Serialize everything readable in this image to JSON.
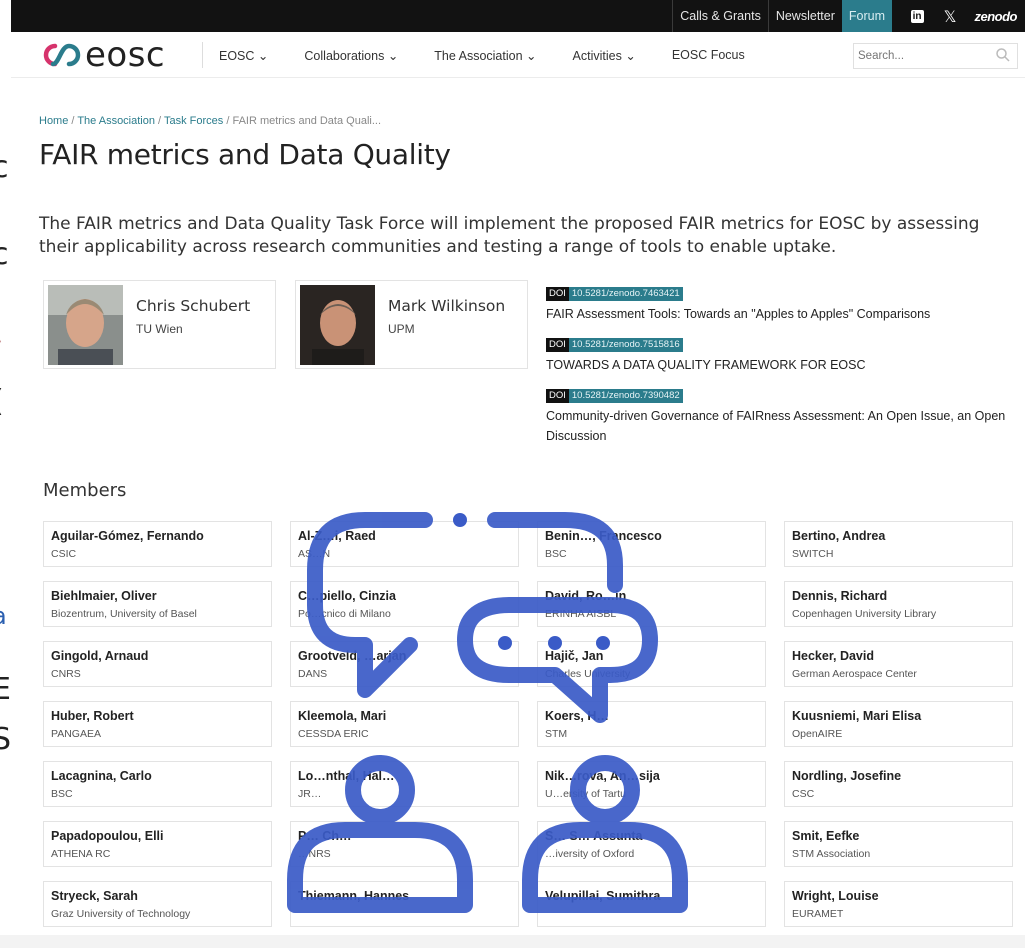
{
  "topbar": {
    "links": [
      "Calls & Grants",
      "Newsletter",
      "Forum"
    ],
    "social": {
      "linkedin": "in",
      "x": "𝕏",
      "zenodo": "zenodo"
    }
  },
  "nav": {
    "logo_text": "eosc",
    "menu": [
      "EOSC",
      "Collaborations",
      "The Association",
      "Activities",
      "EOSC Focus"
    ],
    "search_placeholder": "Search..."
  },
  "breadcrumbs": {
    "items": [
      "Home",
      "The Association",
      "Task Forces"
    ],
    "separator": "/",
    "current": "FAIR metrics and Data Quali..."
  },
  "page": {
    "title": "FAIR metrics and Data Quality",
    "lead": "The FAIR metrics and Data Quality Task Force will implement the proposed FAIR metrics for EOSC by assessing their applicability across research communities and testing a range of tools to enable uptake."
  },
  "leaders": [
    {
      "name": "Chris Schubert",
      "org": "TU Wien"
    },
    {
      "name": "Mark Wilkinson",
      "org": "UPM"
    }
  ],
  "publications": [
    {
      "doi_label": "DOI",
      "doi": "10.5281/zenodo.7463421",
      "title": "FAIR Assessment Tools: Towards an \"Apples to Apples\" Comparisons"
    },
    {
      "doi_label": "DOI",
      "doi": "10.5281/zenodo.7515816",
      "title": "TOWARDS A DATA QUALITY FRAMEWORK FOR EOSC"
    },
    {
      "doi_label": "DOI",
      "doi": "10.5281/zenodo.7390482",
      "title": "Community-driven Governance of FAIRness Assessment: An Open Issue, an Open Discussion"
    }
  ],
  "members_heading": "Members",
  "members": [
    {
      "name": "Aguilar-Gómez, Fernando",
      "org": "CSIC"
    },
    {
      "name": "Al-Z…i, Raed",
      "org": "AS…N"
    },
    {
      "name": "Benin…, Francesco",
      "org": "BSC"
    },
    {
      "name": "Bertino, Andrea",
      "org": "SWITCH"
    },
    {
      "name": "Biehlmaier, Oliver",
      "org": "Biozentrum, University of Basel"
    },
    {
      "name": "C…piello, Cinzia",
      "org": "Po…cnico di Milano"
    },
    {
      "name": "David, Ro…in",
      "org": "ERINHA AISBL"
    },
    {
      "name": "Dennis, Richard",
      "org": "Copenhagen University Library"
    },
    {
      "name": "Gingold, Arnaud",
      "org": "CNRS"
    },
    {
      "name": "Grootveld, …arjan",
      "org": "DANS"
    },
    {
      "name": "Hajič, Jan",
      "org": "Charles University"
    },
    {
      "name": "Hecker, David",
      "org": "German Aerospace Center"
    },
    {
      "name": "Huber, Robert",
      "org": "PANGAEA"
    },
    {
      "name": "Kleemola, Mari",
      "org": "CESSDA ERIC"
    },
    {
      "name": "Koers, H…",
      "org": "STM"
    },
    {
      "name": "Kuusniemi, Mari Elisa",
      "org": "OpenAIRE"
    },
    {
      "name": "Lacagnina, Carlo",
      "org": "BSC"
    },
    {
      "name": "Lo…nthal, Hal…",
      "org": "JR…"
    },
    {
      "name": "Nik…rova, An…sija",
      "org": "U…ersity of Tartu"
    },
    {
      "name": "Nordling, Josefine",
      "org": "CSC"
    },
    {
      "name": "Papadopoulou, Elli",
      "org": "ATHENA RC"
    },
    {
      "name": "P… Ch…",
      "org": "…NRS"
    },
    {
      "name": "S… S… Assunta",
      "org": "…iversity of Oxford"
    },
    {
      "name": "Smit, Eefke",
      "org": "STM Association"
    },
    {
      "name": "Stryeck, Sarah",
      "org": "Graz University of Technology"
    },
    {
      "name": "Thiemann, Hannes",
      "org": ""
    },
    {
      "name": "Velupillai, Sumithra",
      "org": ""
    },
    {
      "name": "Wright, Louise",
      "org": "EURAMET"
    }
  ],
  "colors": {
    "accent": "#2b7c8c",
    "overlay_blue": "#3a5bc7",
    "topbar": "#121212"
  },
  "edge_glyphs": [
    "c",
    "c",
    "\\",
    "(",
    "a",
    "E",
    "S"
  ]
}
